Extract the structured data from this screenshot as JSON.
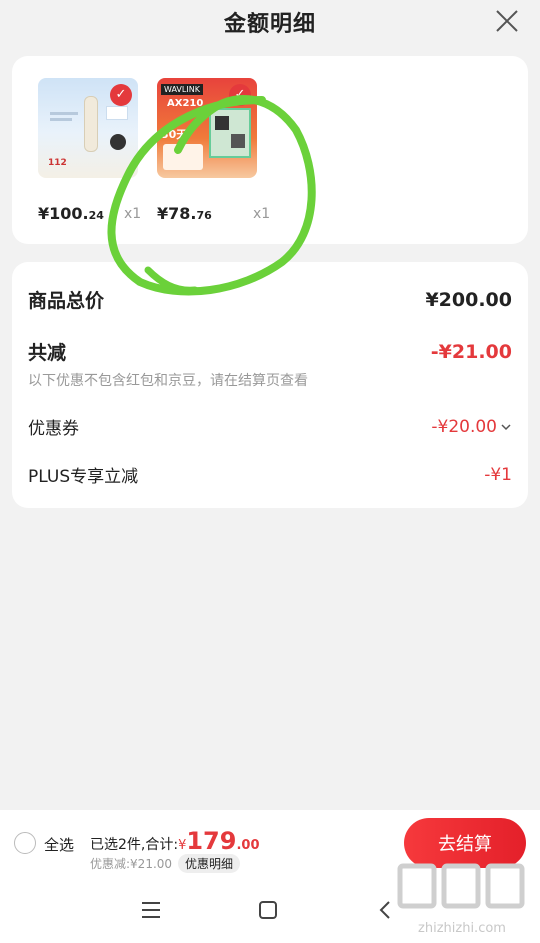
{
  "header": {
    "title": "金额明细"
  },
  "products": [
    {
      "price_int": "¥100.",
      "price_dec": "24",
      "qty": "x1",
      "thumb": {
        "tag": "112"
      }
    },
    {
      "price_int": "¥78.",
      "price_dec": "76",
      "qty": "x1",
      "thumb": {
        "brand": "WAVLINK",
        "model": "AX210",
        "promo": "30天"
      }
    }
  ],
  "summary": {
    "total_label": "商品总价",
    "total_value": "¥200.00",
    "reduce_label": "共减",
    "reduce_value": "-¥21.00",
    "note": "以下优惠不包含红包和京豆，请在结算页查看",
    "coupon_label": "优惠券",
    "coupon_value": "-¥20.00",
    "plus_label": "PLUS专享立减",
    "plus_value": "-¥1"
  },
  "bottom": {
    "select_all": "全选",
    "selected_prefix": "已选2件,合计:",
    "yen": "¥",
    "total_int": "179",
    "total_dec": ".00",
    "discount": "优惠减:¥21.00",
    "detail_tag": "优惠明细",
    "checkout": "去结算"
  },
  "watermark": {
    "text": "zhizhizhi.com"
  },
  "colors": {
    "accent": "#e4393c",
    "annotation": "#6bd13a"
  }
}
